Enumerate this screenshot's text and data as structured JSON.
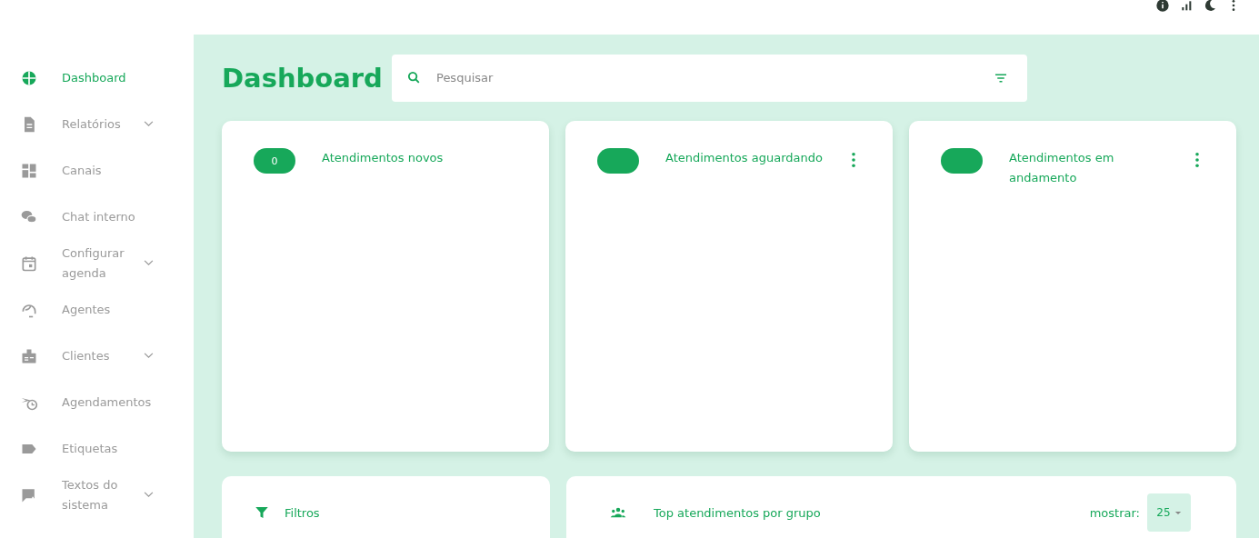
{
  "nav": [
    {
      "label": "Dashboard",
      "selected": true
    },
    {
      "label": "Relatórios",
      "selected": false,
      "expanded": false
    },
    {
      "label": "Canais",
      "selected": false
    },
    {
      "label": "Chat interno",
      "selected": false
    },
    {
      "label": "Configurar agenda",
      "selected": false,
      "expanded": false
    },
    {
      "label": "Agentes",
      "selected": false
    },
    {
      "label": "Clientes",
      "selected": false,
      "expanded": false
    },
    {
      "label": "Agendamentos",
      "selected": false
    },
    {
      "label": "Etiquetas",
      "selected": false
    },
    {
      "label": "Textos do sistema",
      "selected": false,
      "expanded": false
    }
  ],
  "page_title": "Dashboard",
  "search": {
    "placeholder": "Pesquisar"
  },
  "cards": [
    {
      "count": "0",
      "title": "Atendimentos novos",
      "menu": false
    },
    {
      "title": "Atendimentos aguardando",
      "menu": true
    },
    {
      "title": "Atendimentos em andamento",
      "menu": true
    }
  ],
  "filters": {
    "title": "Filtros"
  },
  "top_groups": {
    "title": "Top atendimentos por grupo",
    "show_label": "mostrar:",
    "show_value": "25"
  }
}
